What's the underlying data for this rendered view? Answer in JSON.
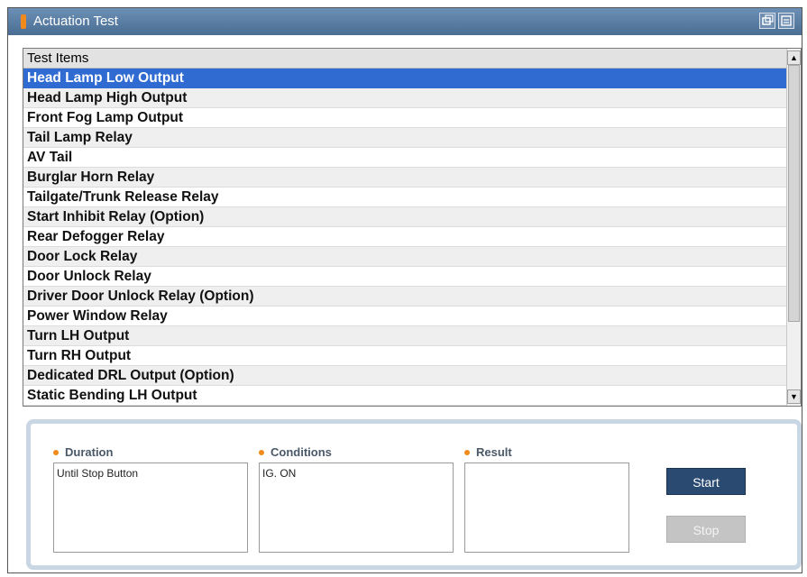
{
  "window": {
    "title": "Actuation Test",
    "title_icon": "orange-bar-icon",
    "controls": [
      "restore-icon",
      "menu-icon"
    ],
    "titlebar_color": "#5a7ea5"
  },
  "list": {
    "header": "Test Items",
    "selected_index": 0,
    "selected_color": "#2f6bd1",
    "items": [
      "Head Lamp Low Output",
      "Head Lamp High Output",
      "Front Fog Lamp Output",
      "Tail Lamp Relay",
      "AV Tail",
      "Burglar Horn Relay",
      "Tailgate/Trunk Release Relay",
      "Start Inhibit Relay (Option)",
      "Rear Defogger Relay",
      "Door Lock Relay",
      "Door Unlock Relay",
      "Driver Door Unlock Relay (Option)",
      "Power Window Relay",
      "Turn LH Output",
      "Turn RH Output",
      "Dedicated DRL Output (Option)",
      "Static Bending LH Output"
    ]
  },
  "panel": {
    "duration_label": "Duration",
    "duration_value": "Until Stop Button",
    "conditions_label": "Conditions",
    "conditions_value": "IG. ON",
    "result_label": "Result",
    "result_value": "",
    "start_label": "Start",
    "stop_label": "Stop",
    "accent_color": "#f08a1c",
    "start_color": "#2a4a72"
  }
}
